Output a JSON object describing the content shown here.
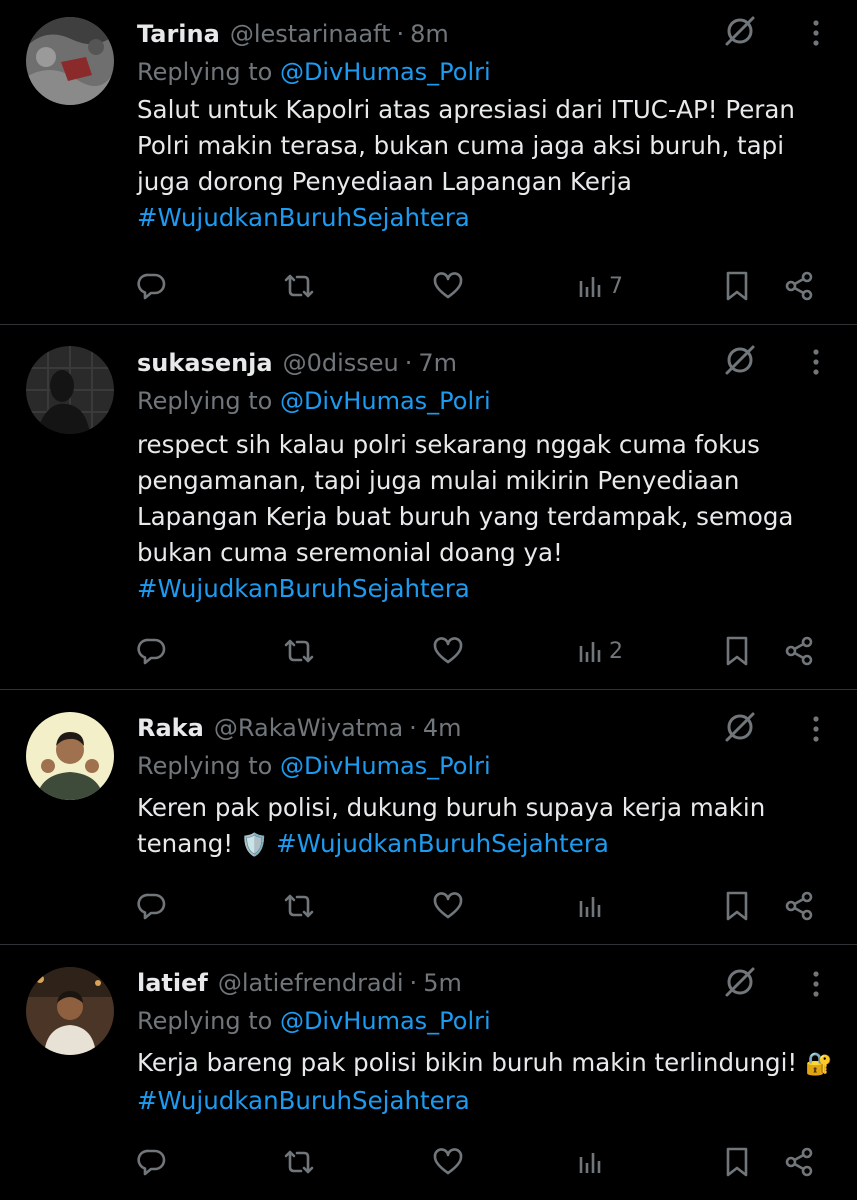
{
  "colors": {
    "background": "#000000",
    "text": "#e7e9ea",
    "muted": "#71767b",
    "link": "#1d9bf0",
    "divider": "#2f3336"
  },
  "replying_prefix": "Replying to",
  "tweets": [
    {
      "name": "Tarina",
      "handle": "@lestarinaaft",
      "separator": "·",
      "time": "8m",
      "replying_to": "@DivHumas_Polri",
      "text": "Salut untuk Kapolri atas apresiasi dari ITUC-AP! Peran Polri makin terasa, bukan cuma jaga aksi buruh, tapi juga dorong Penyediaan Lapangan Kerja",
      "hashtag": "#WujudkanBuruhSejahtera",
      "emoji": "",
      "views": "7"
    },
    {
      "name": "sukasenja",
      "handle": "@0disseu",
      "separator": "·",
      "time": "7m",
      "replying_to": "@DivHumas_Polri",
      "text": "respect sih kalau polri sekarang nggak cuma fokus pengamanan, tapi juga mulai mikirin Penyediaan Lapangan Kerja buat buruh yang terdampak, semoga bukan cuma seremonial doang ya!",
      "hashtag": "#WujudkanBuruhSejahtera",
      "emoji": "",
      "views": "2"
    },
    {
      "name": "Raka",
      "handle": "@RakaWiyatma",
      "separator": "·",
      "time": "4m",
      "replying_to": "@DivHumas_Polri",
      "text": "Keren pak polisi, dukung buruh supaya kerja makin tenang!",
      "hashtag": "#WujudkanBuruhSejahtera",
      "emoji": "🛡️",
      "views": ""
    },
    {
      "name": "latief",
      "handle": "@latiefrendradi",
      "separator": "·",
      "time": "5m",
      "replying_to": "@DivHumas_Polri",
      "text": "Kerja bareng pak polisi bikin buruh makin terlindungi!",
      "hashtag": "#WujudkanBuruhSejahtera",
      "emoji": "🔐",
      "views": ""
    }
  ]
}
